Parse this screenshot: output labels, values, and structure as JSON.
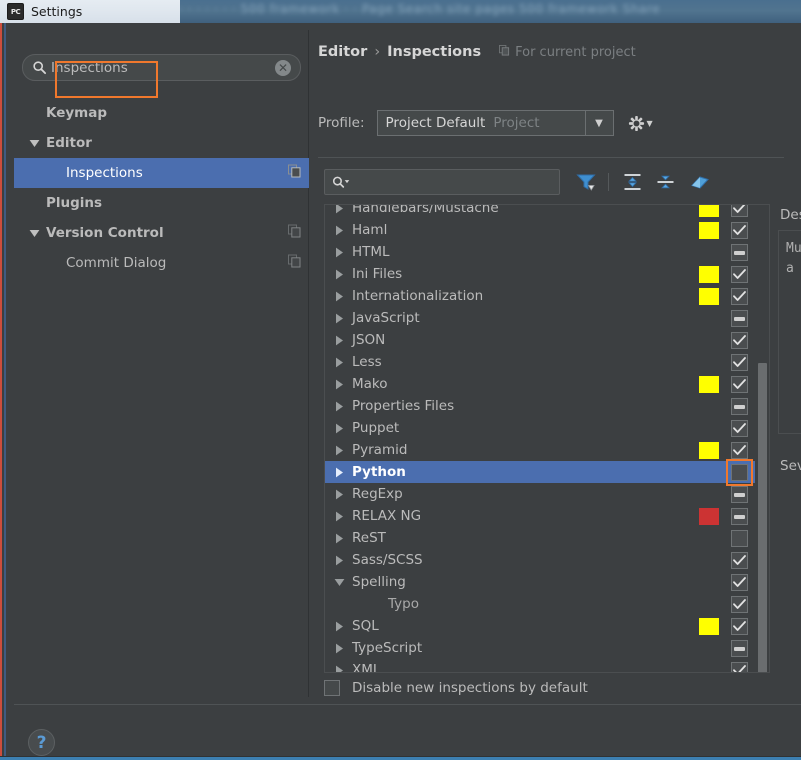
{
  "window": {
    "title": "Settings",
    "icon": "pycharm-icon",
    "backdrop_text": "· · · · · · · · 500 framework · · Page Search site pages 500 framework  Share"
  },
  "colors": {
    "accent_selection": "#4b6eaf",
    "focus_ring": "#f0782d",
    "severity_warning": "#ffff00",
    "severity_error": "#cc3333",
    "window_bg": "#3c3f41",
    "text": "#bbbbbb"
  },
  "sidebar": {
    "search": {
      "value": "Inspections",
      "placeholder": "",
      "search_icon": "search-icon",
      "clear_icon": "clear-icon"
    },
    "items": [
      {
        "label": "Keymap",
        "indent": 0,
        "twisty": "none",
        "bold": true,
        "selected": false,
        "copy_icon": false
      },
      {
        "label": "Editor",
        "indent": 0,
        "twisty": "expanded",
        "bold": true,
        "selected": false,
        "copy_icon": false
      },
      {
        "label": "Inspections",
        "indent": 1,
        "twisty": "none",
        "bold": false,
        "selected": true,
        "copy_icon": true
      },
      {
        "label": "Plugins",
        "indent": 0,
        "twisty": "none",
        "bold": true,
        "selected": false,
        "copy_icon": false
      },
      {
        "label": "Version Control",
        "indent": 0,
        "twisty": "expanded",
        "bold": true,
        "selected": false,
        "copy_icon": true
      },
      {
        "label": "Commit Dialog",
        "indent": 1,
        "twisty": "none",
        "bold": false,
        "selected": false,
        "copy_icon": true
      }
    ]
  },
  "main": {
    "breadcrumb": {
      "parent": "Editor",
      "separator": "›",
      "current": "Inspections"
    },
    "scope": {
      "label": "For current project",
      "icon": "copy-icon"
    },
    "profile": {
      "label": "Profile:",
      "value": "Project Default",
      "suffix": "Project",
      "arrow_icon": "chevron-down-icon",
      "gear_icon": "gear-icon"
    },
    "toolbar": {
      "search_value": "",
      "search_placeholder": "",
      "search_icon": "search-dropdown-icon",
      "buttons": [
        {
          "name": "filter-icon",
          "label": "Filter"
        },
        {
          "name": "expand-all-icon",
          "label": "Expand All"
        },
        {
          "name": "collapse-all-icon",
          "label": "Collapse All"
        },
        {
          "name": "reset-icon",
          "label": "Reset to Empty"
        }
      ]
    },
    "inspections": [
      {
        "label": "Handlebars/Mustache",
        "type": "group",
        "expanded": false,
        "severity": "warning",
        "check": "checked",
        "selected": false,
        "partial_top": true
      },
      {
        "label": "Haml",
        "type": "group",
        "expanded": false,
        "severity": "warning",
        "check": "checked",
        "selected": false
      },
      {
        "label": "HTML",
        "type": "group",
        "expanded": false,
        "severity": "none",
        "check": "mixed",
        "selected": false
      },
      {
        "label": "Ini Files",
        "type": "group",
        "expanded": false,
        "severity": "warning",
        "check": "checked",
        "selected": false
      },
      {
        "label": "Internationalization",
        "type": "group",
        "expanded": false,
        "severity": "warning",
        "check": "checked",
        "selected": false
      },
      {
        "label": "JavaScript",
        "type": "group",
        "expanded": false,
        "severity": "none",
        "check": "mixed",
        "selected": false
      },
      {
        "label": "JSON",
        "type": "group",
        "expanded": false,
        "severity": "none",
        "check": "checked",
        "selected": false
      },
      {
        "label": "Less",
        "type": "group",
        "expanded": false,
        "severity": "none",
        "check": "checked",
        "selected": false
      },
      {
        "label": "Mako",
        "type": "group",
        "expanded": false,
        "severity": "warning",
        "check": "checked",
        "selected": false
      },
      {
        "label": "Properties Files",
        "type": "group",
        "expanded": false,
        "severity": "none",
        "check": "mixed",
        "selected": false
      },
      {
        "label": "Puppet",
        "type": "group",
        "expanded": false,
        "severity": "none",
        "check": "checked",
        "selected": false
      },
      {
        "label": "Pyramid",
        "type": "group",
        "expanded": false,
        "severity": "warning",
        "check": "checked",
        "selected": false
      },
      {
        "label": "Python",
        "type": "group",
        "expanded": false,
        "severity": "none",
        "check": "unchecked",
        "selected": true,
        "focused": true
      },
      {
        "label": "RegExp",
        "type": "group",
        "expanded": false,
        "severity": "none",
        "check": "mixed",
        "selected": false
      },
      {
        "label": "RELAX NG",
        "type": "group",
        "expanded": false,
        "severity": "error",
        "check": "mixed",
        "selected": false
      },
      {
        "label": "ReST",
        "type": "group",
        "expanded": false,
        "severity": "none",
        "check": "unchecked",
        "selected": false
      },
      {
        "label": "Sass/SCSS",
        "type": "group",
        "expanded": false,
        "severity": "none",
        "check": "checked",
        "selected": false
      },
      {
        "label": "Spelling",
        "type": "group",
        "expanded": true,
        "severity": "none",
        "check": "checked",
        "selected": false
      },
      {
        "label": "Typo",
        "type": "child",
        "expanded": false,
        "severity": "none",
        "check": "checked",
        "selected": false
      },
      {
        "label": "SQL",
        "type": "group",
        "expanded": false,
        "severity": "warning",
        "check": "checked",
        "selected": false
      },
      {
        "label": "TypeScript",
        "type": "group",
        "expanded": false,
        "severity": "none",
        "check": "mixed",
        "selected": false
      },
      {
        "label": "XML",
        "type": "group",
        "expanded": false,
        "severity": "none",
        "check": "checked",
        "selected": false
      }
    ],
    "disable_new": {
      "label": "Disable new inspections by default",
      "checked": false
    }
  },
  "description_panel": {
    "title": "Descri",
    "line1": "Multi",
    "line2": "a sin",
    "severity_label": "Sever"
  },
  "footer": {
    "help_icon": "help-icon",
    "help_label": "?"
  }
}
